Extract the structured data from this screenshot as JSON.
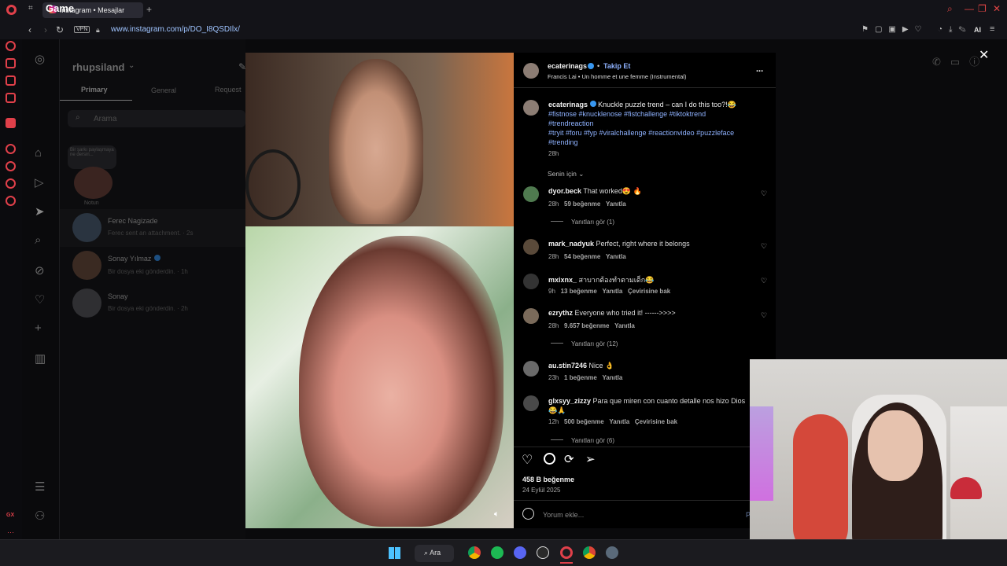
{
  "browser": {
    "overlay_label": "Game",
    "tab_title": "Instagram • Mesajlar",
    "new_tab": "+",
    "vpn": "VPN",
    "url": "www.instagram.com/p/DO_I8QSDIlx/",
    "ai_label": "AI",
    "sidebar_badge": "GX"
  },
  "inbox": {
    "username": "rhupsiland",
    "tabs": [
      "Primary",
      "General",
      "Request"
    ],
    "search_placeholder": "Arama",
    "note_text": "Bir şarkı paylaşmaya ne dersin...",
    "note_label": "Notun",
    "threads": [
      {
        "name": "Ferec Nagizade",
        "preview": "Ferec sent an attachment. · 2s"
      },
      {
        "name": "Sonay Yılmaz",
        "preview": "Bir dosya eki gönderdin. · 1h"
      },
      {
        "name": "Sonay",
        "preview": "Bir dosya eki gönderdin. · 2h"
      }
    ]
  },
  "post": {
    "author": "ecaterinags",
    "follow": "Takip Et",
    "audio": "Francis Lai • Un homme et une femme (Instrumental)",
    "more": "...",
    "caption_text": "Knuckle puzzle trend – can I do this too?!😂",
    "caption_tags_1": "#fistnose #knucklenose #fistchallenge #tiktoktrend",
    "caption_tags_2": "#trendreaction",
    "caption_tags_3": "#tryit #foru #fyp #viralchallenge #reactionvideo #puzzleface",
    "caption_tags_4": "#trending",
    "caption_time": "28h",
    "sort": "Senin için",
    "comments": [
      {
        "user": "dyor.beck",
        "text": "That worked😍 🔥",
        "time": "28h",
        "likes": "59 beğenme",
        "reply": "Yanıtla",
        "translate": "",
        "replies": "Yanıtları gör (1)"
      },
      {
        "user": "mark_nadyuk",
        "text": "Perfect, right where it belongs",
        "time": "28h",
        "likes": "54 beğenme",
        "reply": "Yanıtla",
        "translate": "",
        "replies": ""
      },
      {
        "user": "mxixnx_",
        "text": "สาบากต้องทำตามเด็ก😂",
        "time": "9h",
        "likes": "13 beğenme",
        "reply": "Yanıtla",
        "translate": "Çevirisine bak",
        "replies": ""
      },
      {
        "user": "ezrythz",
        "text": "Everyone who tried it! ------>>>>",
        "time": "28h",
        "likes": "9.657 beğenme",
        "reply": "Yanıtla",
        "translate": "",
        "replies": "Yanıtları gör (12)"
      },
      {
        "user": "au.stin7246",
        "text": "Nice 👌",
        "time": "23h",
        "likes": "1 beğenme",
        "reply": "Yanıtla",
        "translate": "",
        "replies": ""
      },
      {
        "user": "glxsyy_zizzy",
        "text": "Para que miren con cuanto detalle nos hizo Dios",
        "text2": "😂🙏",
        "time": "12h",
        "likes": "500 beğenme",
        "reply": "Yanıtla",
        "translate": "Çevirisine bak",
        "replies": "Yanıtları gör (6)"
      }
    ],
    "like_count": "458 B beğenme",
    "date": "24 Eylül 2025",
    "comment_placeholder": "Yorum ekle...",
    "post_btn": "P"
  },
  "taskbar": {
    "search": "Ara"
  },
  "colors": {
    "accent_blue": "#8fb2ff",
    "opera_red": "#e0404a",
    "verified": "#3897f0"
  }
}
